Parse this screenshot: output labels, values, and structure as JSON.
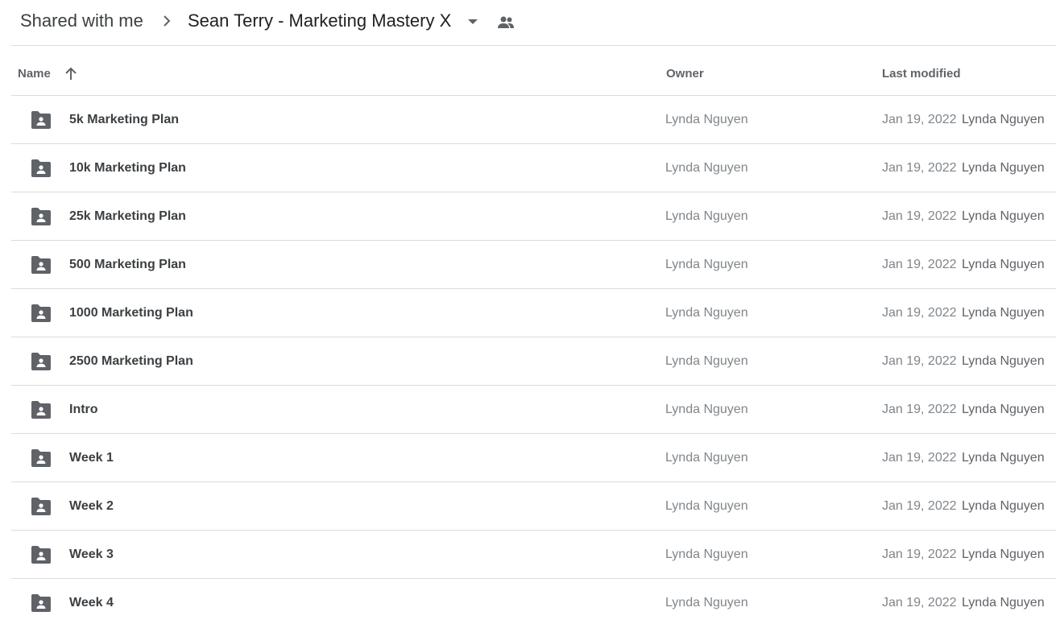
{
  "breadcrumb": {
    "root": "Shared with me",
    "current": "Sean Terry - Marketing Mastery X"
  },
  "icons": {
    "separator": "chevron-right-icon",
    "dropdown": "caret-down-icon",
    "shared": "people-icon",
    "sort": "arrow-up-icon",
    "folder": "shared-folder-icon"
  },
  "columns": {
    "name": "Name",
    "owner": "Owner",
    "last_modified": "Last modified"
  },
  "rows": [
    {
      "name": "5k Marketing Plan",
      "owner": "Lynda Nguyen",
      "date": "Jan 19, 2022",
      "modified_by": "Lynda Nguyen"
    },
    {
      "name": "10k Marketing Plan",
      "owner": "Lynda Nguyen",
      "date": "Jan 19, 2022",
      "modified_by": "Lynda Nguyen"
    },
    {
      "name": "25k Marketing Plan",
      "owner": "Lynda Nguyen",
      "date": "Jan 19, 2022",
      "modified_by": "Lynda Nguyen"
    },
    {
      "name": "500 Marketing Plan",
      "owner": "Lynda Nguyen",
      "date": "Jan 19, 2022",
      "modified_by": "Lynda Nguyen"
    },
    {
      "name": "1000 Marketing Plan",
      "owner": "Lynda Nguyen",
      "date": "Jan 19, 2022",
      "modified_by": "Lynda Nguyen"
    },
    {
      "name": "2500 Marketing Plan",
      "owner": "Lynda Nguyen",
      "date": "Jan 19, 2022",
      "modified_by": "Lynda Nguyen"
    },
    {
      "name": "Intro",
      "owner": "Lynda Nguyen",
      "date": "Jan 19, 2022",
      "modified_by": "Lynda Nguyen"
    },
    {
      "name": "Week 1",
      "owner": "Lynda Nguyen",
      "date": "Jan 19, 2022",
      "modified_by": "Lynda Nguyen"
    },
    {
      "name": "Week 2",
      "owner": "Lynda Nguyen",
      "date": "Jan 19, 2022",
      "modified_by": "Lynda Nguyen"
    },
    {
      "name": "Week 3",
      "owner": "Lynda Nguyen",
      "date": "Jan 19, 2022",
      "modified_by": "Lynda Nguyen"
    },
    {
      "name": "Week 4",
      "owner": "Lynda Nguyen",
      "date": "Jan 19, 2022",
      "modified_by": "Lynda Nguyen"
    }
  ]
}
